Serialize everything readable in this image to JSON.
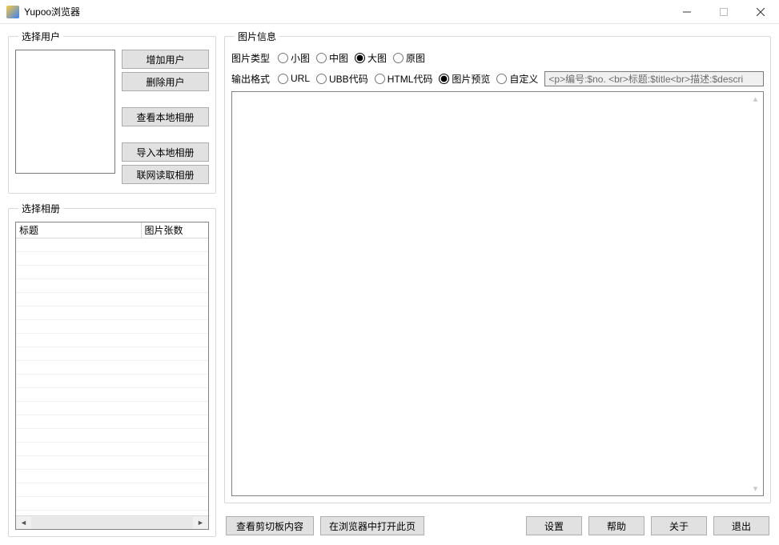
{
  "window": {
    "title": "Yupoo浏览器"
  },
  "user_panel": {
    "legend": "选择用户",
    "buttons": {
      "add": "增加用户",
      "delete": "删除用户",
      "view_local": "查看本地相册",
      "import_local": "导入本地相册",
      "fetch_online": "联网读取相册"
    }
  },
  "album_panel": {
    "legend": "选择相册",
    "columns": {
      "title": "标题",
      "count": "图片张数"
    }
  },
  "info_panel": {
    "legend": "图片信息",
    "image_type": {
      "label": "图片类型",
      "options": {
        "small": "小图",
        "medium": "中图",
        "large": "大图",
        "original": "原图"
      },
      "selected": "large"
    },
    "output_format": {
      "label": "输出格式",
      "options": {
        "url": "URL",
        "ubb": "UBB代码",
        "html": "HTML代码",
        "preview": "图片预览",
        "custom": "自定义"
      },
      "selected": "preview",
      "template": "<p>编号:$no. <br>标题:$title<br>描述:$descri"
    }
  },
  "bottom": {
    "view_clipboard": "查看剪切板内容",
    "open_in_browser": "在浏览器中打开此页",
    "settings": "设置",
    "help": "帮助",
    "about": "关于",
    "exit": "退出"
  }
}
